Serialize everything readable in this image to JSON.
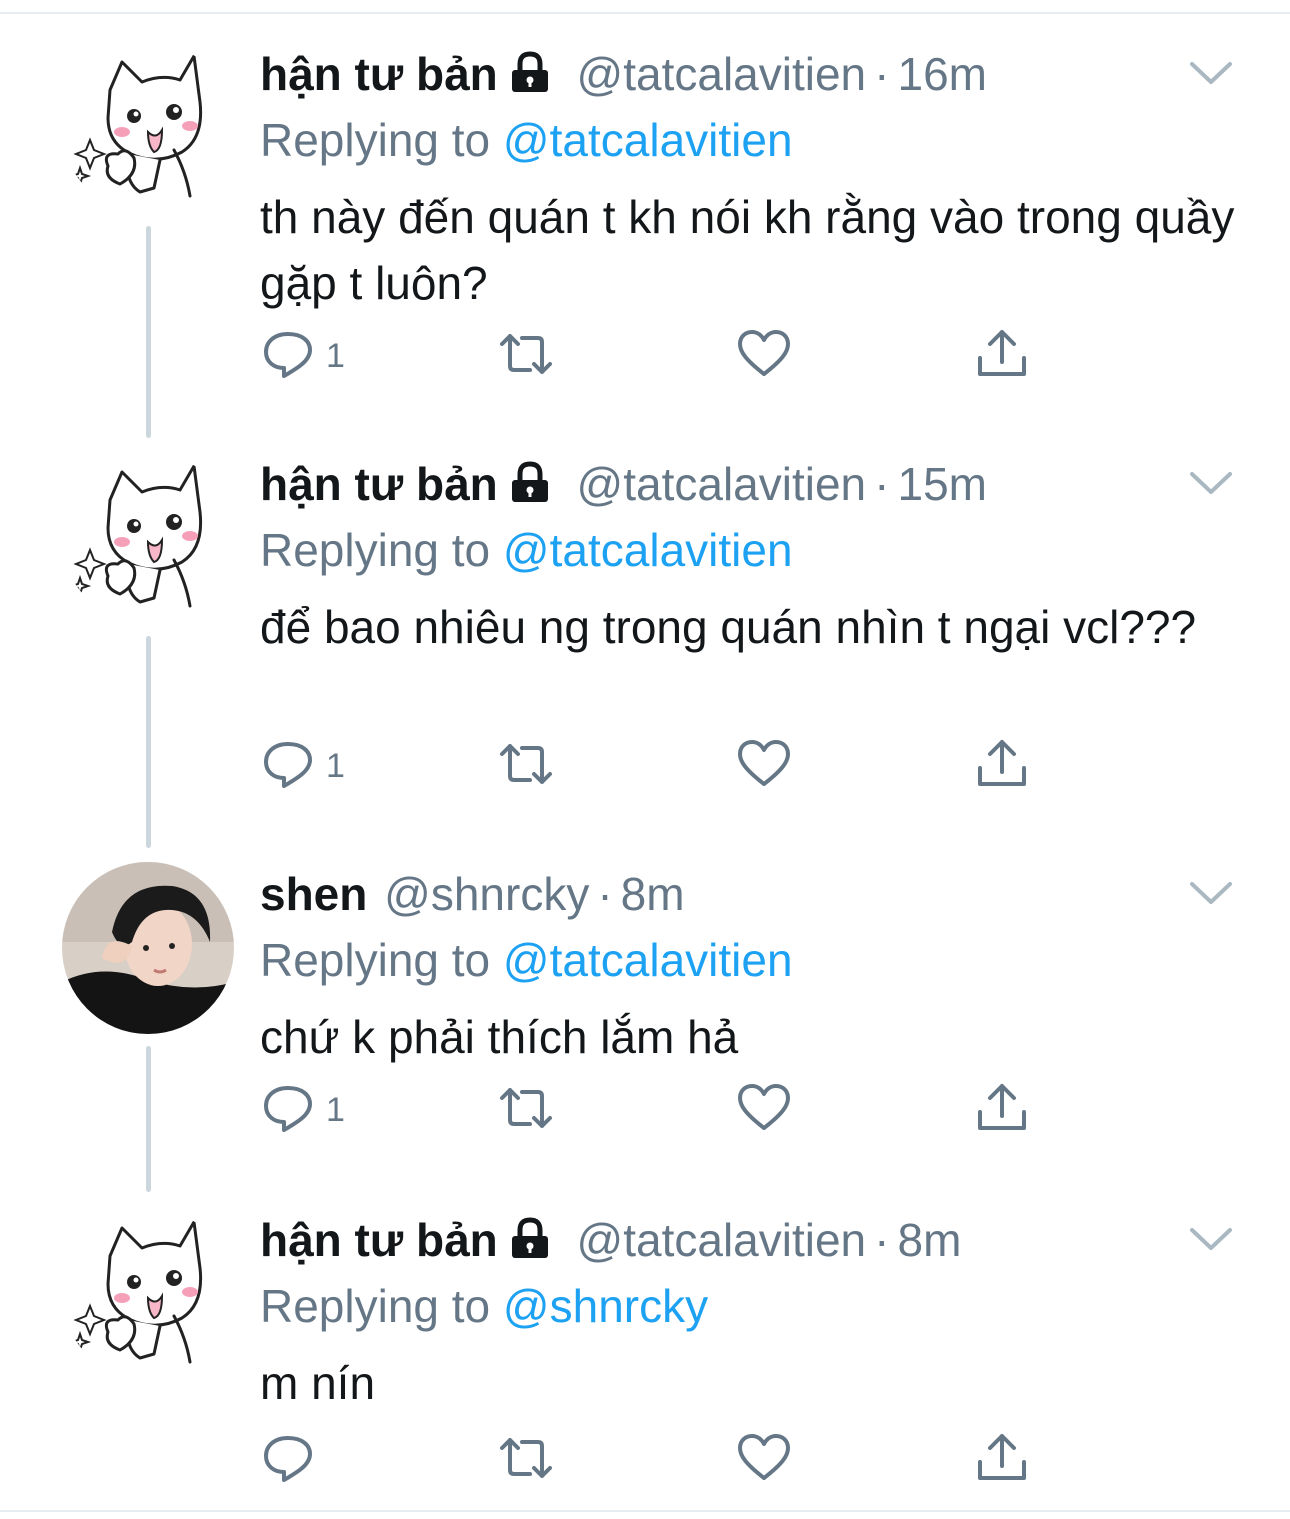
{
  "tweets": [
    {
      "display_name": "hận tư bản",
      "locked": true,
      "handle": "@tatcalavitien",
      "time": "16m",
      "replying_prefix": "Replying to",
      "replying_to": "@tatcalavitien",
      "text": "th này đến quán t kh nói kh rằng vào trong quầy gặp t luôn?",
      "reply_count": "1",
      "avatar": "cat-sticker"
    },
    {
      "display_name": "hận tư bản",
      "locked": true,
      "handle": "@tatcalavitien",
      "time": "15m",
      "replying_prefix": "Replying to",
      "replying_to": "@tatcalavitien",
      "text": "để bao nhiêu ng trong quán nhìn t ngại vcl???",
      "reply_count": "1",
      "avatar": "cat-sticker"
    },
    {
      "display_name": "shen",
      "locked": false,
      "handle": "@shnrcky",
      "time": "8m",
      "replying_prefix": "Replying to",
      "replying_to": "@tatcalavitien",
      "text": "chứ k phải thích lắm hả",
      "reply_count": "1",
      "avatar": "person-photo"
    },
    {
      "display_name": "hận tư bản",
      "locked": true,
      "handle": "@tatcalavitien",
      "time": "8m",
      "replying_prefix": "Replying to",
      "replying_to": "@shnrcky",
      "text": "m nín",
      "reply_count": "",
      "avatar": "cat-sticker"
    }
  ],
  "separator": "·",
  "icons": {
    "reply": "speech-bubble-icon",
    "retweet": "retweet-icon",
    "like": "heart-icon",
    "share": "share-icon",
    "menu": "chevron-down-icon",
    "protected": "lock-icon"
  },
  "colors": {
    "text": "#14171a",
    "secondary": "#657786",
    "link": "#1da1f2",
    "thread_line": "#ccd6dd",
    "divider": "#e6ecf0"
  }
}
